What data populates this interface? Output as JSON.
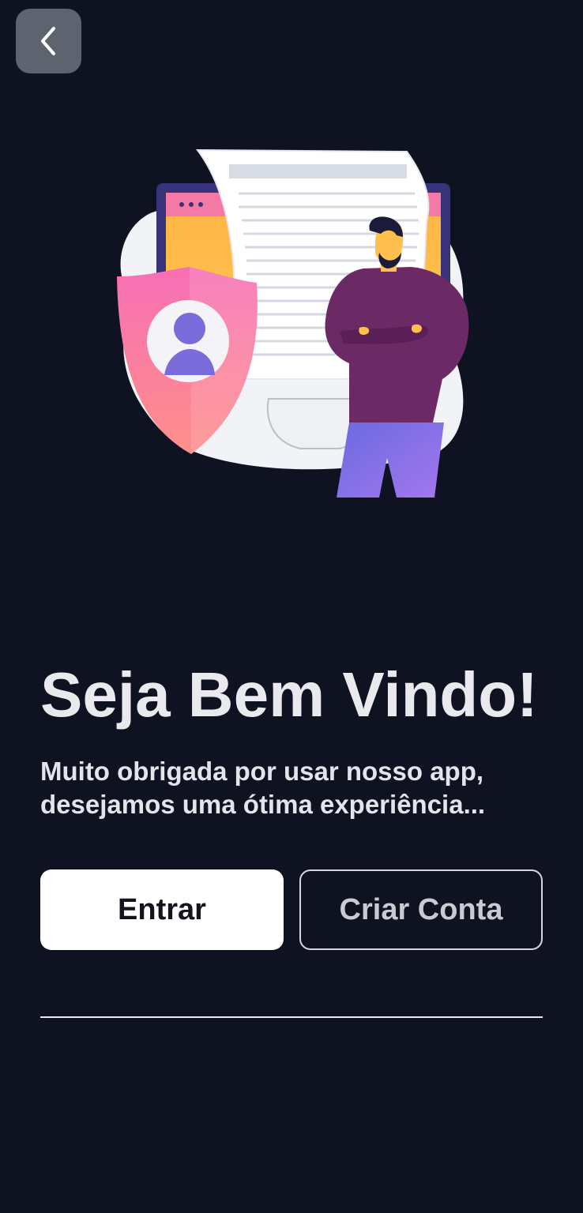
{
  "nav": {
    "back_icon": "chevron-left-icon"
  },
  "illustration": {
    "name": "security-illustration"
  },
  "welcome": {
    "title": "Seja Bem Vindo!",
    "subtitle": "Muito obrigada por usar nosso app, desejamos uma ótima experiência..."
  },
  "actions": {
    "login_label": "Entrar",
    "signup_label": "Criar Conta"
  },
  "colors": {
    "background": "#0e1221",
    "primary_button": "#ffffff",
    "outline_button_border": "#d6d6dc"
  }
}
